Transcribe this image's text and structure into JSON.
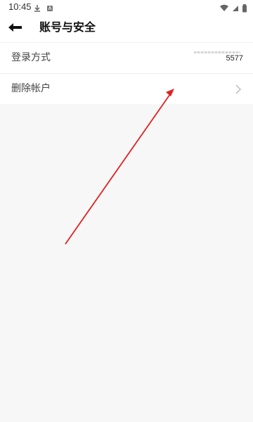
{
  "status_bar": {
    "time": "10:45",
    "left_icons": [
      "download-icon",
      "android-icon"
    ],
    "right_icons": [
      "wifi-icon",
      "signal-icon",
      "battery-icon"
    ]
  },
  "header": {
    "title": "账号与安全",
    "back_icon": "back-arrow-icon"
  },
  "list": {
    "items": [
      {
        "label": "登录方式",
        "value": "5577"
      },
      {
        "label": "删除帐户",
        "icon": "chevron-right-icon"
      }
    ]
  },
  "colors": {
    "background": "#f7f7f7",
    "surface": "#ffffff",
    "annotation": "#e02020"
  }
}
